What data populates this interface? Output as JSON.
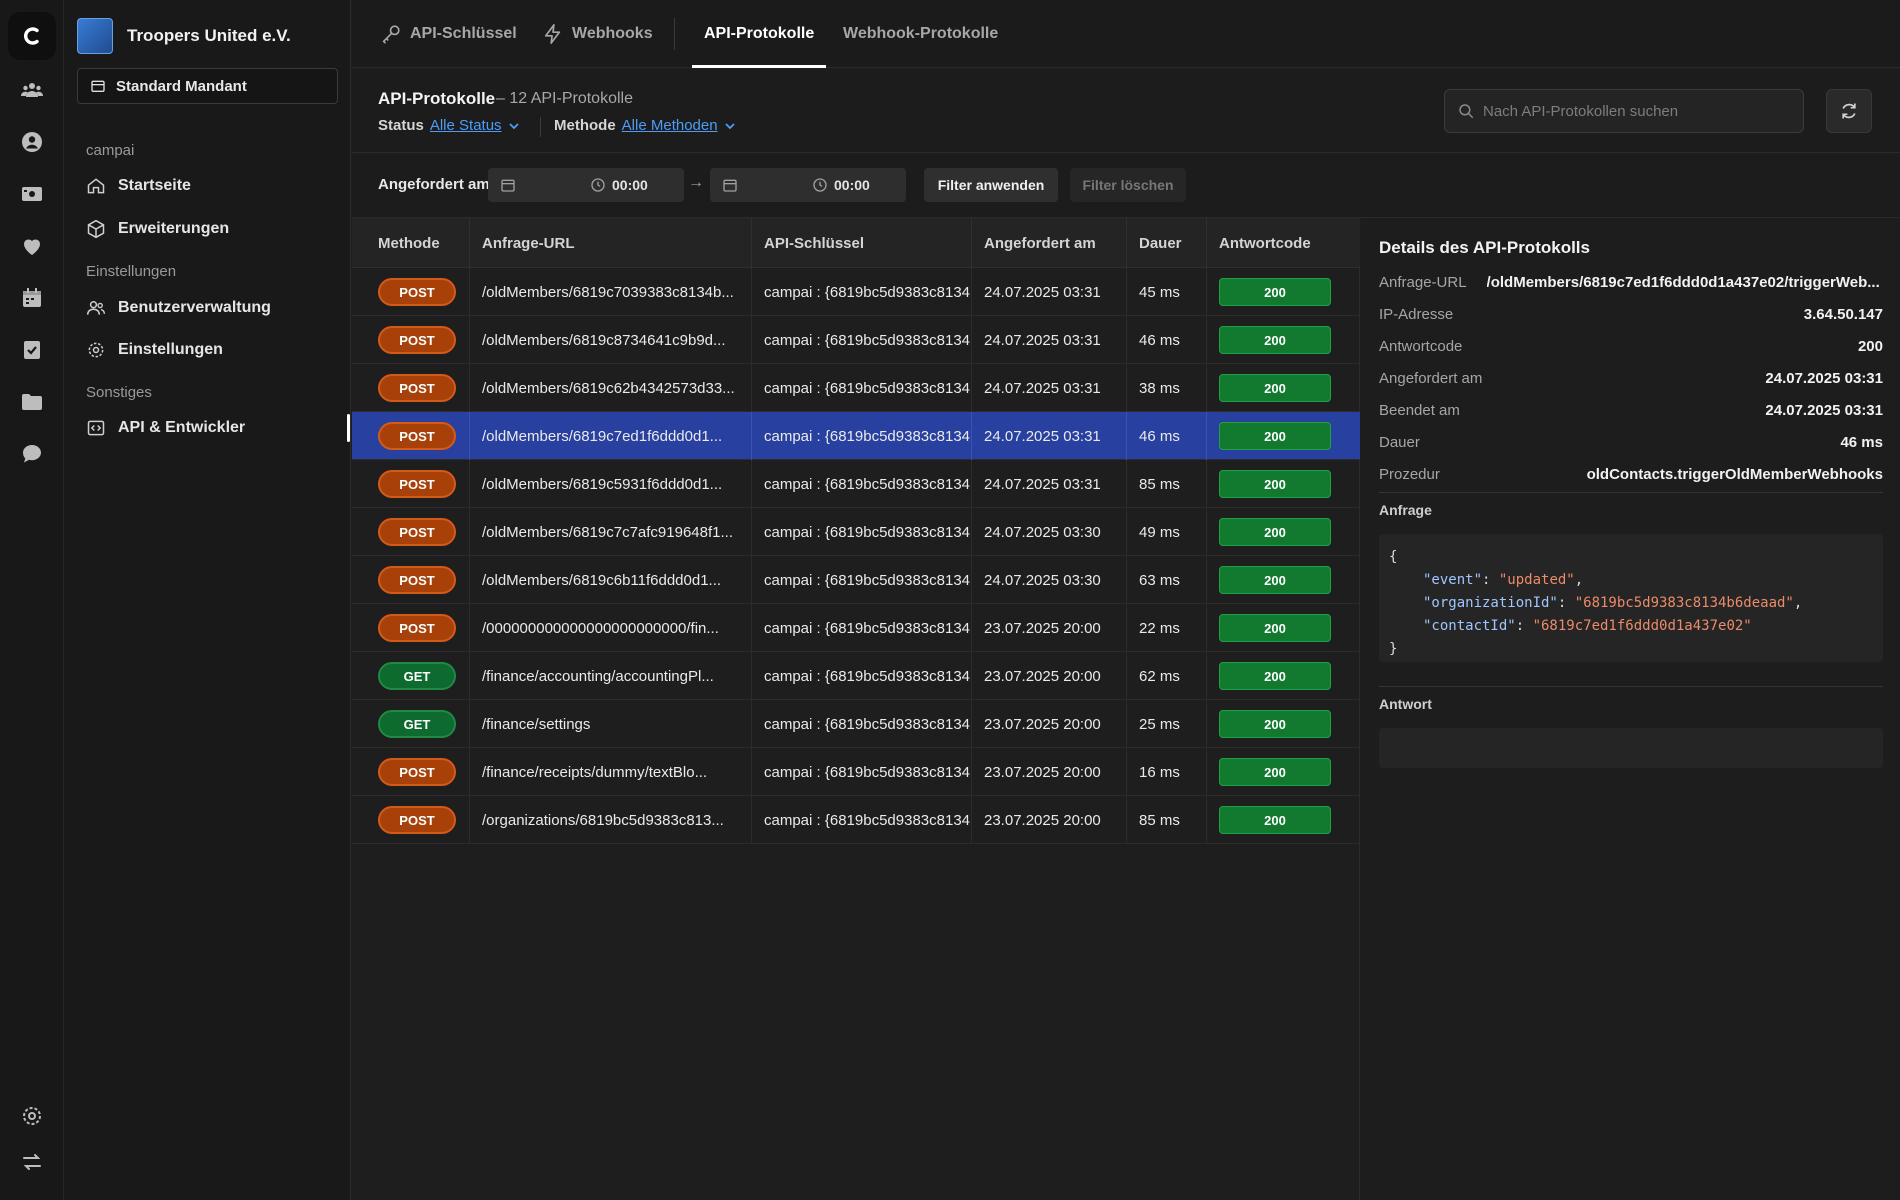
{
  "rail": {
    "icons": [
      "campai-logo",
      "members-icon",
      "contact-icon",
      "finance-icon",
      "heart-icon",
      "calendar-icon",
      "tasks-icon",
      "folder-icon",
      "chat-icon",
      "settings-icon",
      "switch-icon"
    ]
  },
  "sidebar": {
    "org_name": "Troopers United e.V.",
    "tenant": "Standard Mandant",
    "sections": [
      {
        "label": "campai",
        "items": [
          {
            "label": "Startseite",
            "icon": "home-icon"
          },
          {
            "label": "Erweiterungen",
            "icon": "cube-icon"
          }
        ]
      },
      {
        "label": "Einstellungen",
        "items": [
          {
            "label": "Benutzerverwaltung",
            "icon": "users-icon"
          },
          {
            "label": "Einstellungen",
            "icon": "gear-icon"
          }
        ]
      },
      {
        "label": "Sonstiges",
        "items": [
          {
            "label": "API & Entwickler",
            "icon": "code-icon",
            "active": true
          }
        ]
      }
    ]
  },
  "tabs": [
    {
      "label": "API-Schlüssel",
      "icon": "key-icon"
    },
    {
      "label": "Webhooks",
      "icon": "bolt-icon"
    },
    {
      "label": "API-Protokolle",
      "active": true
    },
    {
      "label": "Webhook-Protokolle"
    }
  ],
  "header": {
    "title": "API-Protokolle",
    "subtitle": "– 12 API-Protokolle",
    "status_label": "Status",
    "status_value": "Alle Status",
    "method_label": "Methode",
    "method_value": "Alle Methoden",
    "search_placeholder": "Nach API-Protokollen suchen"
  },
  "date_filter": {
    "label": "Angefordert am",
    "from_time": "00:00",
    "to_time": "00:00",
    "arrow": "→",
    "apply_label": "Filter anwenden",
    "clear_label": "Filter löschen"
  },
  "table": {
    "columns": [
      "Methode",
      "Anfrage-URL",
      "API-Schlüssel",
      "Angefordert am",
      "Dauer",
      "Antwortcode"
    ],
    "rows": [
      {
        "method": "POST",
        "url": "/oldMembers/6819c7039383c8134b...",
        "key": "campai : {6819bc5d9383c8134",
        "requested": "24.07.2025 03:31",
        "duration": "45 ms",
        "code": "200"
      },
      {
        "method": "POST",
        "url": "/oldMembers/6819c8734641c9b9d...",
        "key": "campai : {6819bc5d9383c8134",
        "requested": "24.07.2025 03:31",
        "duration": "46 ms",
        "code": "200"
      },
      {
        "method": "POST",
        "url": "/oldMembers/6819c62b4342573d33...",
        "key": "campai : {6819bc5d9383c8134",
        "requested": "24.07.2025 03:31",
        "duration": "38 ms",
        "code": "200"
      },
      {
        "method": "POST",
        "url": "/oldMembers/6819c7ed1f6ddd0d1...",
        "key": "campai : {6819bc5d9383c8134",
        "requested": "24.07.2025 03:31",
        "duration": "46 ms",
        "code": "200",
        "selected": true
      },
      {
        "method": "POST",
        "url": "/oldMembers/6819c5931f6ddd0d1...",
        "key": "campai : {6819bc5d9383c8134",
        "requested": "24.07.2025 03:31",
        "duration": "85 ms",
        "code": "200"
      },
      {
        "method": "POST",
        "url": "/oldMembers/6819c7c7afc919648f1...",
        "key": "campai : {6819bc5d9383c8134",
        "requested": "24.07.2025 03:30",
        "duration": "49 ms",
        "code": "200"
      },
      {
        "method": "POST",
        "url": "/oldMembers/6819c6b11f6ddd0d1...",
        "key": "campai : {6819bc5d9383c8134",
        "requested": "24.07.2025 03:30",
        "duration": "63 ms",
        "code": "200"
      },
      {
        "method": "POST",
        "url": "/000000000000000000000000/fin...",
        "key": "campai : {6819bc5d9383c8134",
        "requested": "23.07.2025 20:00",
        "duration": "22 ms",
        "code": "200"
      },
      {
        "method": "GET",
        "url": "/finance/accounting/accountingPl...",
        "key": "campai : {6819bc5d9383c8134",
        "requested": "23.07.2025 20:00",
        "duration": "62 ms",
        "code": "200"
      },
      {
        "method": "GET",
        "url": "/finance/settings",
        "key": "campai : {6819bc5d9383c8134",
        "requested": "23.07.2025 20:00",
        "duration": "25 ms",
        "code": "200"
      },
      {
        "method": "POST",
        "url": "/finance/receipts/dummy/textBlo...",
        "key": "campai : {6819bc5d9383c8134",
        "requested": "23.07.2025 20:00",
        "duration": "16 ms",
        "code": "200"
      },
      {
        "method": "POST",
        "url": "/organizations/6819bc5d9383c813...",
        "key": "campai : {6819bc5d9383c8134",
        "requested": "23.07.2025 20:00",
        "duration": "85 ms",
        "code": "200"
      }
    ]
  },
  "detail": {
    "title": "Details des API-Protokolls",
    "fields": [
      {
        "label": "Anfrage-URL",
        "value": "/oldMembers/6819c7ed1f6ddd0d1a437e02/triggerWeb..."
      },
      {
        "label": "IP-Adresse",
        "value": "3.64.50.147"
      },
      {
        "label": "Antwortcode",
        "value": "200"
      },
      {
        "label": "Angefordert am",
        "value": "24.07.2025 03:31"
      },
      {
        "label": "Beendet am",
        "value": "24.07.2025 03:31"
      },
      {
        "label": "Dauer",
        "value": "46 ms"
      },
      {
        "label": "Prozedur",
        "value": "oldContacts.triggerOldMemberWebhooks"
      }
    ],
    "request_label": "Anfrage",
    "request_body": [
      {
        "key": "\"event\"",
        "value": "\"updated\"",
        "trail": ","
      },
      {
        "key": "\"organizationId\"",
        "value": "\"6819bc5d9383c8134b6deaad\"",
        "trail": ","
      },
      {
        "key": "\"contactId\"",
        "value": "\"6819c7ed1f6ddd0d1a437e02\"",
        "trail": ""
      }
    ],
    "open_brace": "{",
    "close_brace": "}",
    "colon": ": ",
    "response_label": "Antwort"
  },
  "colors": {
    "post": "#a8400a",
    "get": "#0e6a2e",
    "ok": "#117a2e",
    "selected_row": "#2840a0",
    "link": "#4e9cf7"
  }
}
